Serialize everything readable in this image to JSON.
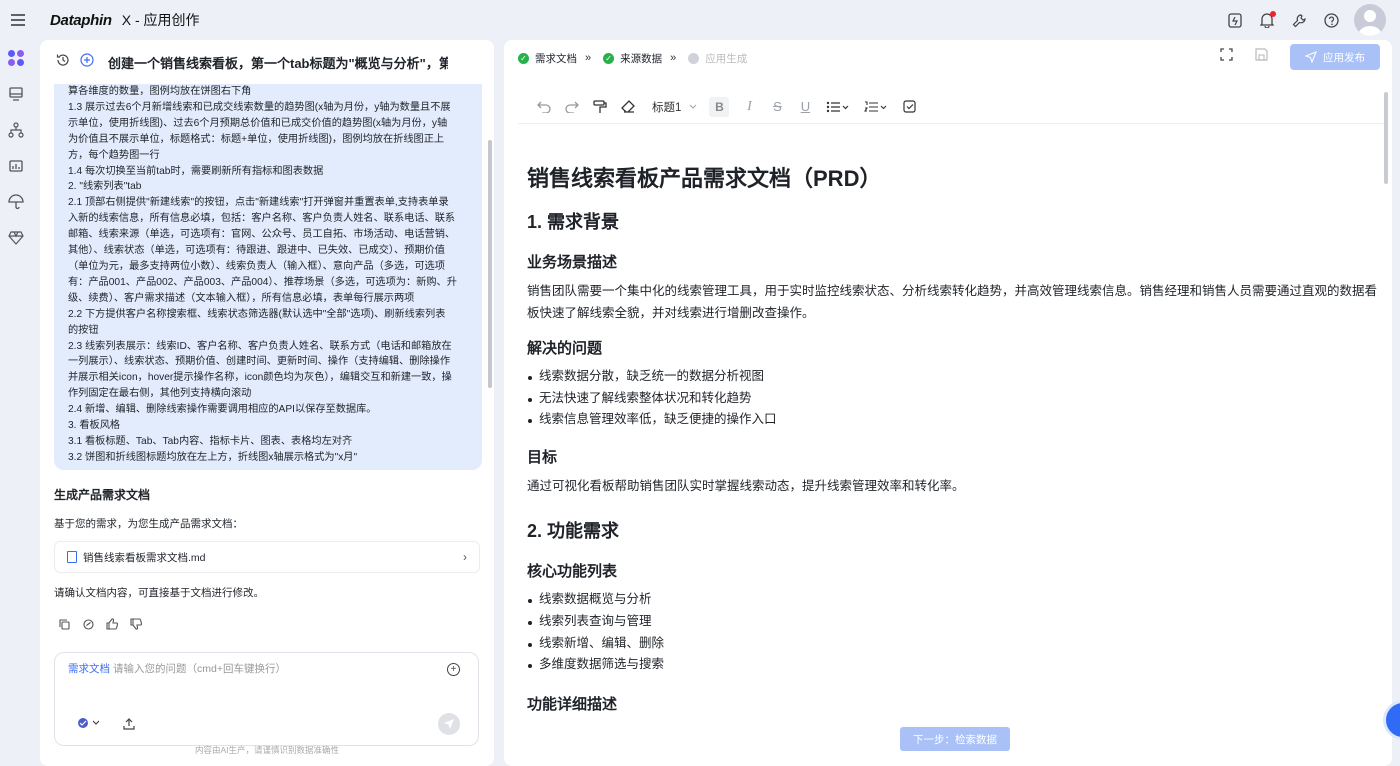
{
  "topbar": {
    "brand": "Dataphin",
    "app_title": "X - 应用创作"
  },
  "chat": {
    "title": "创建一个销售线索看板，第一个tab标题为\"概览与分析\"，第二",
    "bubble_lines": [
      "算各维度的数量，图例均放在饼图右下角",
      "1.3 展示过去6个月新增线索和已成交线索数量的趋势图(x轴为月份，y轴为数量且不展",
      "示单位，使用折线图)、过去6个月预期总价值和已成交价值的趋势图(x轴为月份，y轴",
      "为价值且不展示单位，标题格式：标题+单位，使用折线图)，图例均放在折线图正上",
      "方，每个趋势图一行",
      "1.4 每次切换至当前tab时，需要刷新所有指标和图表数据",
      "2. \"线索列表\"tab",
      "2.1 顶部右侧提供\"新建线索\"的按钮，点击\"新建线索\"打开弹窗并重置表单,支持表单录",
      "入新的线索信息，所有信息必填，包括：客户名称、客户负责人姓名、联系电话、联系",
      "邮箱、线索来源（单选，可选项有：官网、公众号、员工自拓、市场活动、电话营销、",
      "其他）、线索状态（单选，可选项有：待跟进、跟进中、已失效、已成交）、预期价值",
      "（单位为元，最多支持两位小数）、线索负责人（输入框）、意向产品（多选，可选项",
      "有：产品001、产品002、产品003、产品004）、推荐场景（多选，可选项为：新购、升",
      "级、续费）、客户需求描述（文本输入框），所有信息必填，表单每行展示两项",
      "2.2 下方提供客户名称搜索框、线索状态筛选器(默认选中\"全部\"选项)、刷新线索列表",
      "的按钮",
      "2.3 线索列表展示：线索ID、客户名称、客户负责人姓名、联系方式（电话和邮箱放在",
      "一列展示）、线索状态、预期价值、创建时间、更新时间、操作（支持编辑、删除操作",
      "并展示相关icon，hover提示操作名称，icon颜色均为灰色），编辑交互和新建一致，操",
      "作列固定在最右侧，其他列支持横向滚动",
      "2.4 新增、编辑、删除线索操作需要调用相应的API以保存至数据库。",
      "3. 看板风格",
      "3.1 看板标题、Tab、Tab内容、指标卡片、图表、表格均左对齐",
      "3.2 饼图和折线图标题均放在左上方，折线图x轴展示格式为\"x月\""
    ],
    "section_title": "生成产品需求文档",
    "section_desc": "基于您的需求，为您生成产品需求文档：",
    "file_name": "销售线索看板需求文档.md",
    "confirm_text": "请确认文档内容，可直接基于文档进行修改。",
    "input_tag": "需求文档",
    "input_placeholder": "请输入您的问题（cmd+回车键换行）",
    "disclaimer": "内容由AI生产，请谨慎识别数据准确性"
  },
  "steps": [
    {
      "label": "需求文档",
      "state": "done"
    },
    {
      "label": "来源数据",
      "state": "done"
    },
    {
      "label": "应用生成",
      "state": "disabled"
    }
  ],
  "publish_label": "应用发布",
  "toolbar": {
    "heading_value": "标题1"
  },
  "doc": {
    "title": "销售线索看板产品需求文档（PRD）",
    "s1_title": "1. 需求背景",
    "s1_sub1": "业务场景描述",
    "s1_para": "销售团队需要一个集中化的线索管理工具，用于实时监控线索状态、分析线索转化趋势，并高效管理线索信息。销售经理和销售人员需要通过直观的数据看板快速了解线索全貌，并对线索进行增删改查操作。",
    "s1_sub2": "解决的问题",
    "problems": [
      "线索数据分散，缺乏统一的数据分析视图",
      "无法快速了解线索整体状况和转化趋势",
      "线索信息管理效率低，缺乏便捷的操作入口"
    ],
    "s1_sub3": "目标",
    "goal": "通过可视化看板帮助销售团队实时掌握线索动态，提升线索管理效率和转化率。",
    "s2_title": "2. 功能需求",
    "s2_sub1": "核心功能列表",
    "features": [
      "线索数据概览与分析",
      "线索列表查询与管理",
      "线索新增、编辑、删除",
      "多维度数据筛选与搜索"
    ],
    "s2_sub2": "功能详细描述"
  },
  "next_label": "下一步：检索数据",
  "colors": {
    "accent": "#3b6cf6",
    "bubble": "#e3ecfd",
    "success": "#27b14b",
    "button_disabled": "#a9c1f7"
  }
}
